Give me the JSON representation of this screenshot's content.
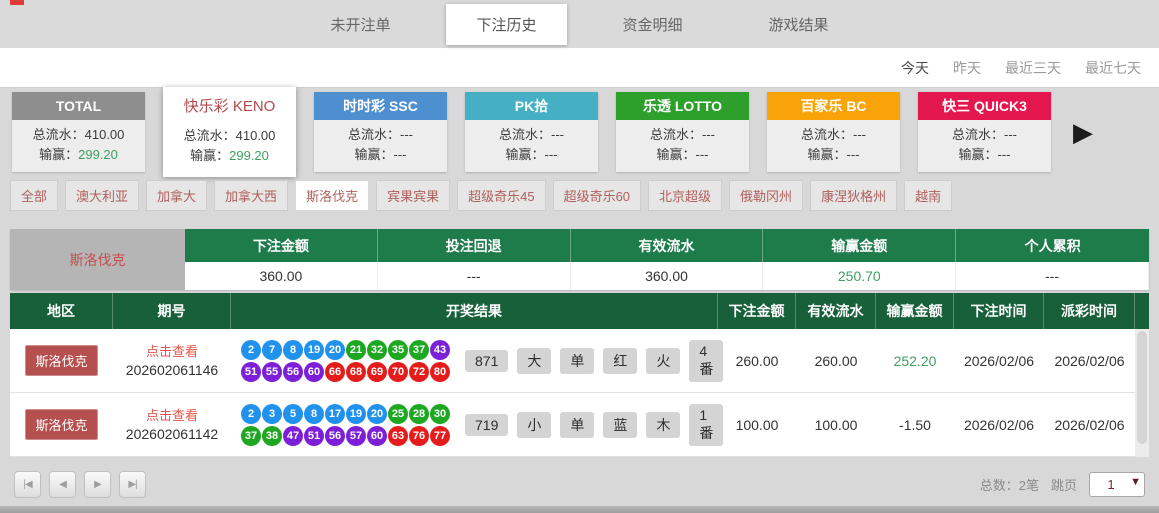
{
  "tabs": {
    "items": [
      {
        "label": "未开注单",
        "active": false
      },
      {
        "label": "下注历史",
        "active": true
      },
      {
        "label": "资金明细",
        "active": false
      },
      {
        "label": "游戏结果",
        "active": false
      }
    ]
  },
  "date_filters": {
    "items": [
      {
        "label": "今天",
        "active": true
      },
      {
        "label": "昨天",
        "active": false
      },
      {
        "label": "最近三天",
        "active": false
      },
      {
        "label": "最近七天",
        "active": false
      }
    ]
  },
  "game_cards": {
    "flow_label": "总流水：",
    "winloss_label": "输赢：",
    "next_arrow": "▶",
    "items": [
      {
        "name": "TOTAL",
        "header_bg": "#8e8e8e",
        "header_text": "#ffffff",
        "flow": "410.00",
        "winloss": "299.20",
        "winloss_green": true,
        "selected": false
      },
      {
        "name": "快乐彩 KENO",
        "header_bg": "#ffffff",
        "header_text": "#b2494d",
        "flow": "410.00",
        "winloss": "299.20",
        "winloss_green": true,
        "selected": true
      },
      {
        "name": "时时彩 SSC",
        "header_bg": "#4e8fd0",
        "header_text": "#ffffff",
        "flow": "---",
        "winloss": "---",
        "winloss_green": false,
        "selected": false
      },
      {
        "name": "PK拾",
        "header_bg": "#45b0c4",
        "header_text": "#ffffff",
        "flow": "---",
        "winloss": "---",
        "winloss_green": false,
        "selected": false
      },
      {
        "name": "乐透 LOTTO",
        "header_bg": "#2da02c",
        "header_text": "#ffffff",
        "flow": "---",
        "winloss": "---",
        "winloss_green": false,
        "selected": false
      },
      {
        "name": "百家乐 BC",
        "header_bg": "#f8a408",
        "header_text": "#ffffff",
        "flow": "---",
        "winloss": "---",
        "winloss_green": false,
        "selected": false
      },
      {
        "name": "快三 QUICK3",
        "header_bg": "#e4164e",
        "header_text": "#ffffff",
        "flow": "---",
        "winloss": "---",
        "winloss_green": false,
        "selected": false
      }
    ]
  },
  "region_filters": {
    "items": [
      {
        "label": "全部",
        "active": false
      },
      {
        "label": "澳大利亚",
        "active": false
      },
      {
        "label": "加拿大",
        "active": false
      },
      {
        "label": "加拿大西",
        "active": false
      },
      {
        "label": "斯洛伐克",
        "active": true
      },
      {
        "label": "宾果宾果",
        "active": false
      },
      {
        "label": "超级奇乐45",
        "active": false
      },
      {
        "label": "超级奇乐60",
        "active": false
      },
      {
        "label": "北京超级",
        "active": false
      },
      {
        "label": "俄勒冈州",
        "active": false
      },
      {
        "label": "康涅狄格州",
        "active": false
      },
      {
        "label": "越南",
        "active": false
      }
    ]
  },
  "summary": {
    "region": "斯洛伐克",
    "columns": [
      {
        "header": "下注金额",
        "value": "360.00",
        "green": false
      },
      {
        "header": "投注回退",
        "value": "---",
        "green": false
      },
      {
        "header": "有效流水",
        "value": "360.00",
        "green": false
      },
      {
        "header": "输赢金额",
        "value": "250.70",
        "green": true
      },
      {
        "header": "个人累积",
        "value": "---",
        "green": false
      }
    ]
  },
  "bet_table": {
    "headers": [
      "地区",
      "期号",
      "开奖结果",
      "下注金额",
      "有效流水",
      "输赢金额",
      "下注时间",
      "派彩时间"
    ],
    "rows": [
      {
        "region": "斯洛伐克",
        "view_link": "点击查看",
        "period": "202602061146",
        "balls": [
          [
            {
              "n": "2",
              "color": "#2191ee"
            },
            {
              "n": "7",
              "color": "#2191ee"
            },
            {
              "n": "8",
              "color": "#2191ee"
            },
            {
              "n": "19",
              "color": "#2191ee"
            },
            {
              "n": "20",
              "color": "#2191ee"
            },
            {
              "n": "21",
              "color": "#1ea821"
            },
            {
              "n": "32",
              "color": "#1ea821"
            },
            {
              "n": "35",
              "color": "#1ea821"
            },
            {
              "n": "37",
              "color": "#1ea821"
            },
            {
              "n": "43",
              "color": "#7d1fd6"
            }
          ],
          [
            {
              "n": "51",
              "color": "#7d1fd6"
            },
            {
              "n": "55",
              "color": "#7d1fd6"
            },
            {
              "n": "56",
              "color": "#7d1fd6"
            },
            {
              "n": "60",
              "color": "#7d1fd6"
            },
            {
              "n": "66",
              "color": "#e51c1c"
            },
            {
              "n": "68",
              "color": "#e51c1c"
            },
            {
              "n": "69",
              "color": "#e51c1c"
            },
            {
              "n": "70",
              "color": "#e51c1c"
            },
            {
              "n": "72",
              "color": "#e51c1c"
            },
            {
              "n": "80",
              "color": "#e51c1c"
            }
          ]
        ],
        "tags": [
          "871",
          "大",
          "单",
          "红",
          "火",
          "4番"
        ],
        "bet_amount": "260.00",
        "valid_amount": "260.00",
        "winloss": "252.20",
        "winloss_green": true,
        "bet_time": "2026/02/06",
        "payout_time": "2026/02/06"
      },
      {
        "region": "斯洛伐克",
        "view_link": "点击查看",
        "period": "202602061142",
        "balls": [
          [
            {
              "n": "2",
              "color": "#2191ee"
            },
            {
              "n": "3",
              "color": "#2191ee"
            },
            {
              "n": "5",
              "color": "#2191ee"
            },
            {
              "n": "8",
              "color": "#2191ee"
            },
            {
              "n": "17",
              "color": "#2191ee"
            },
            {
              "n": "19",
              "color": "#2191ee"
            },
            {
              "n": "20",
              "color": "#2191ee"
            },
            {
              "n": "25",
              "color": "#1ea821"
            },
            {
              "n": "28",
              "color": "#1ea821"
            },
            {
              "n": "30",
              "color": "#1ea821"
            }
          ],
          [
            {
              "n": "37",
              "color": "#1ea821"
            },
            {
              "n": "38",
              "color": "#1ea821"
            },
            {
              "n": "47",
              "color": "#7d1fd6"
            },
            {
              "n": "51",
              "color": "#7d1fd6"
            },
            {
              "n": "56",
              "color": "#7d1fd6"
            },
            {
              "n": "57",
              "color": "#7d1fd6"
            },
            {
              "n": "60",
              "color": "#7d1fd6"
            },
            {
              "n": "63",
              "color": "#e51c1c"
            },
            {
              "n": "76",
              "color": "#e51c1c"
            },
            {
              "n": "77",
              "color": "#e51c1c"
            }
          ]
        ],
        "tags": [
          "719",
          "小",
          "单",
          "蓝",
          "木",
          "1番"
        ],
        "bet_amount": "100.00",
        "valid_amount": "100.00",
        "winloss": "-1.50",
        "winloss_green": false,
        "bet_time": "2026/02/06",
        "payout_time": "2026/02/06"
      }
    ]
  },
  "pagination": {
    "buttons": [
      {
        "id": "first-page-button",
        "glyph": "|◀"
      },
      {
        "id": "prev-page-button",
        "glyph": "◀"
      },
      {
        "id": "next-page-button",
        "glyph": "▶"
      },
      {
        "id": "last-page-button",
        "glyph": "▶|"
      }
    ],
    "total": "总数：2笔",
    "jump": "跳页",
    "page": "1",
    "caret": "▼"
  }
}
